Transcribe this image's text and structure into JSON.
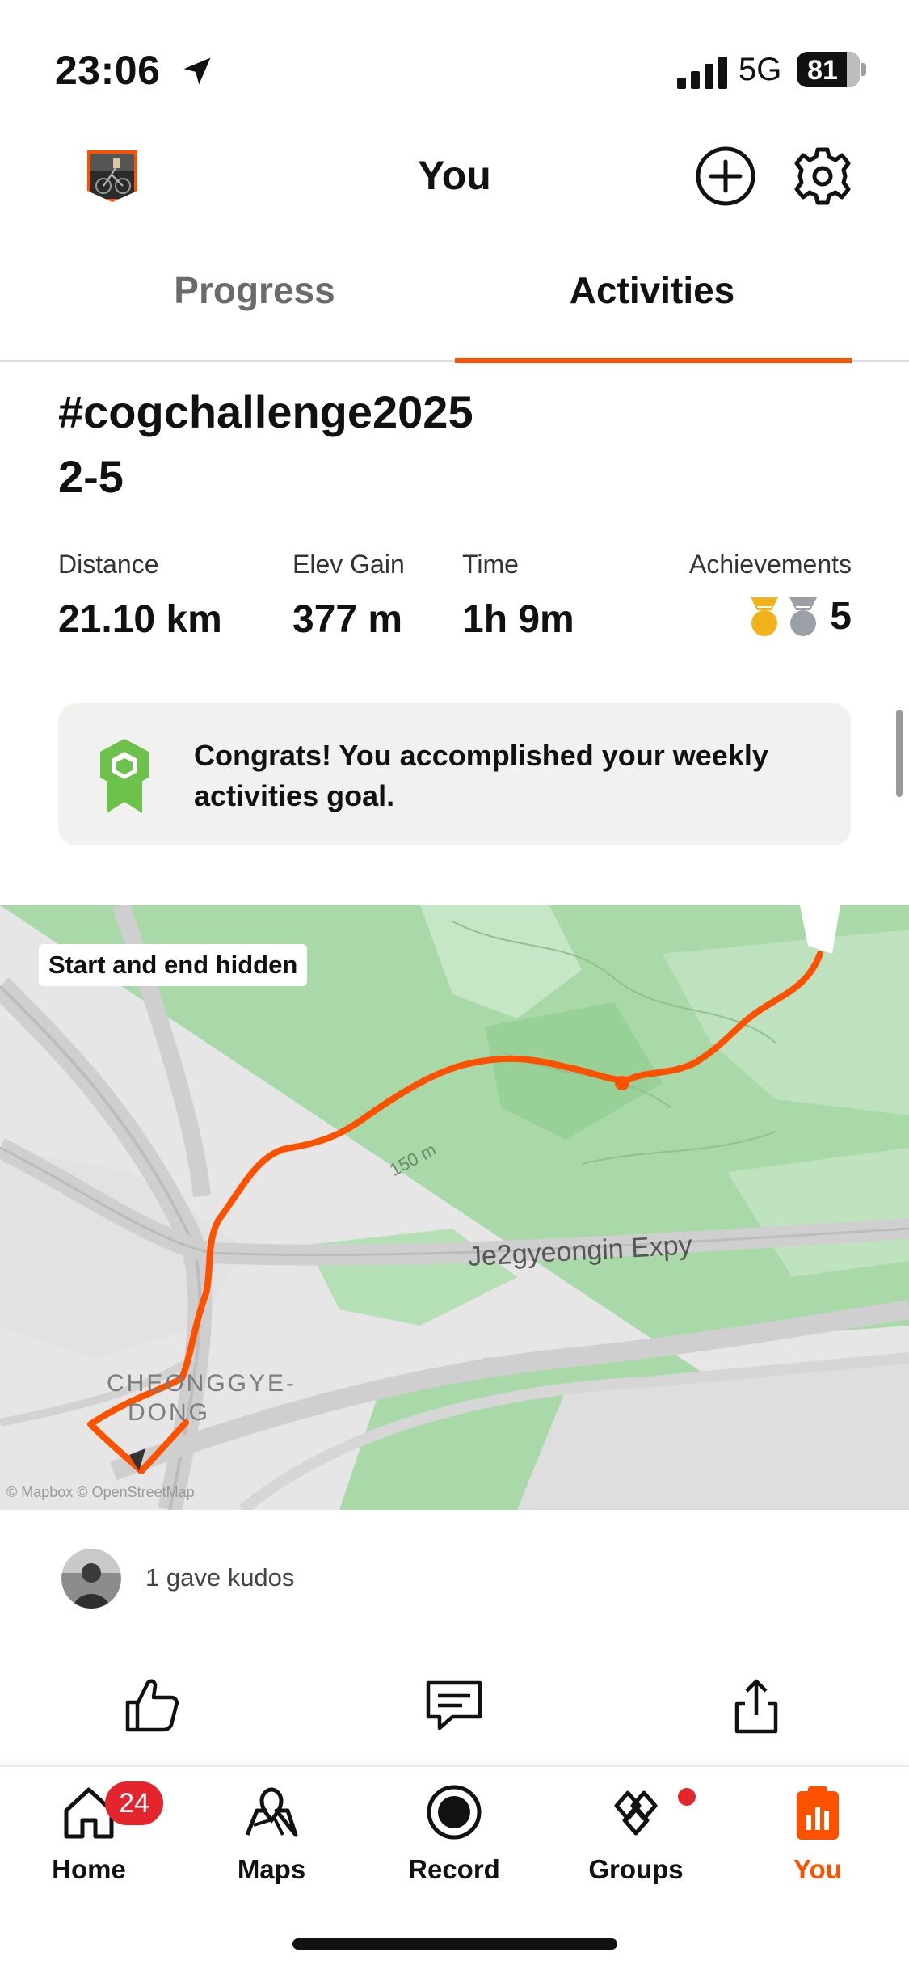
{
  "status_bar": {
    "time": "23:06",
    "network": "5G",
    "battery": "81"
  },
  "header": {
    "title": "You"
  },
  "tabs": [
    {
      "label": "Progress",
      "active": false
    },
    {
      "label": "Activities",
      "active": true
    }
  ],
  "activity": {
    "title_line1": "#cogchallenge2025",
    "title_line2": "2-5",
    "stats": {
      "distance": {
        "label": "Distance",
        "value": "21.10 km"
      },
      "elev_gain": {
        "label": "Elev Gain",
        "value": "377 m"
      },
      "time": {
        "label": "Time",
        "value": "1h 9m"
      },
      "achievements": {
        "label": "Achievements",
        "value": "5",
        "icons": [
          "gold-medal-icon",
          "silver-medal-icon"
        ]
      }
    },
    "goal_message": "Congrats! You accomplished your weekly activities goal."
  },
  "map": {
    "badge": "Start and end hidden",
    "road_label": "Je2gyeongin Expy",
    "elevation_label": "150 m",
    "district_line1": "CHEONGGYE-",
    "district_line2": "DONG",
    "attribution": "© Mapbox © OpenStreetMap",
    "route_color": "#fc5200"
  },
  "kudos": {
    "text": "1 gave kudos"
  },
  "actions": [
    "thumbs-up-icon",
    "comment-icon",
    "share-icon"
  ],
  "bottom_nav": {
    "items": [
      {
        "label": "Home",
        "badge": "24"
      },
      {
        "label": "Maps"
      },
      {
        "label": "Record"
      },
      {
        "label": "Groups",
        "dot": true
      },
      {
        "label": "You",
        "active": true
      }
    ]
  },
  "colors": {
    "accent": "#fc5200",
    "badge": "#e3262d",
    "goal_icon": "#6cc24a"
  }
}
